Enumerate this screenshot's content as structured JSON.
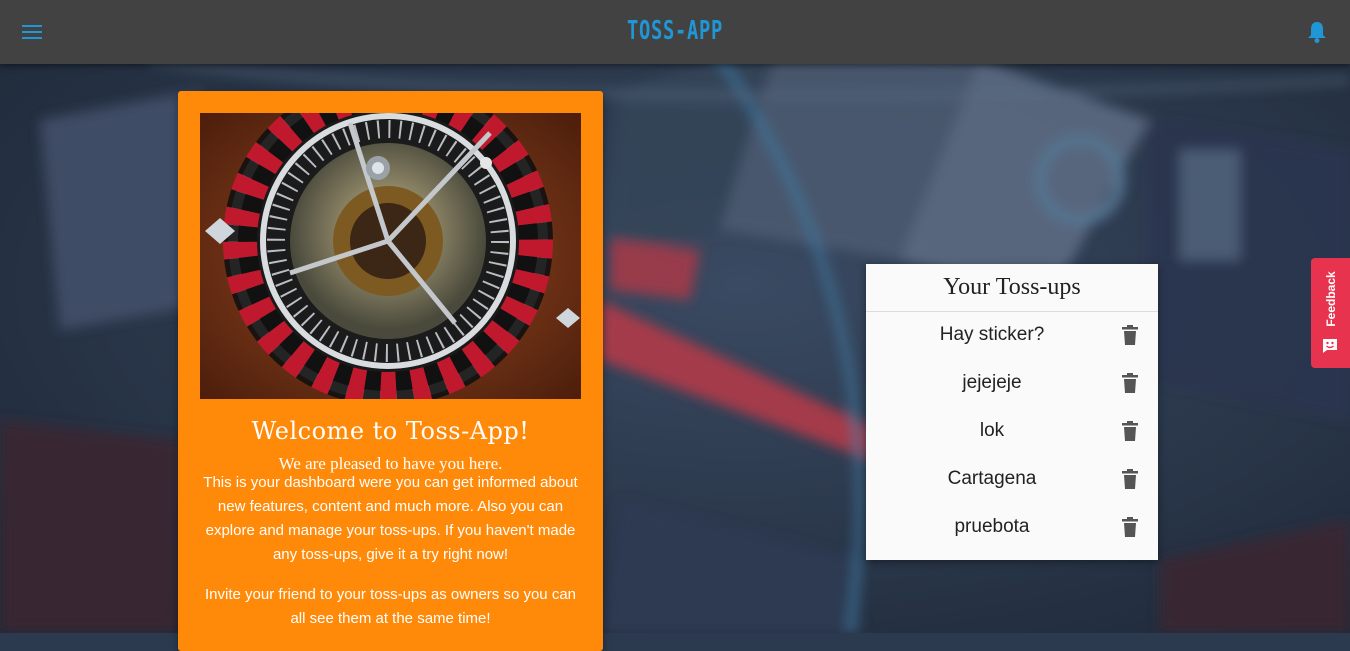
{
  "header": {
    "brand": "TOSS-APP",
    "menu_icon": "menu-icon",
    "notification_icon": "bell-icon"
  },
  "welcome": {
    "image_alt": "roulette wheel",
    "title": "Welcome to Toss-App!",
    "subtitle": "We are pleased to have you here.",
    "body": "This is your dashboard were you can get informed about new features, content and much more. Also you can explore and manage your toss-ups. If you haven't made any toss-ups, give it a try right now!",
    "invite": "Invite your friend to your toss-ups as owners so you can all see them at the same time!"
  },
  "tossups": {
    "title": "Your Toss-ups",
    "items": [
      {
        "label": "Hay sticker?"
      },
      {
        "label": "jejejeje"
      },
      {
        "label": "lok"
      },
      {
        "label": "Cartagena"
      },
      {
        "label": "pruebota"
      }
    ],
    "delete_icon": "trash-icon"
  },
  "feedback": {
    "label": "Feedback",
    "icon": "smiley-icon"
  },
  "colors": {
    "topbar": "#424242",
    "accent": "#2196d6",
    "welcome_card": "#ff8a0a",
    "feedback": "#e8334f"
  }
}
